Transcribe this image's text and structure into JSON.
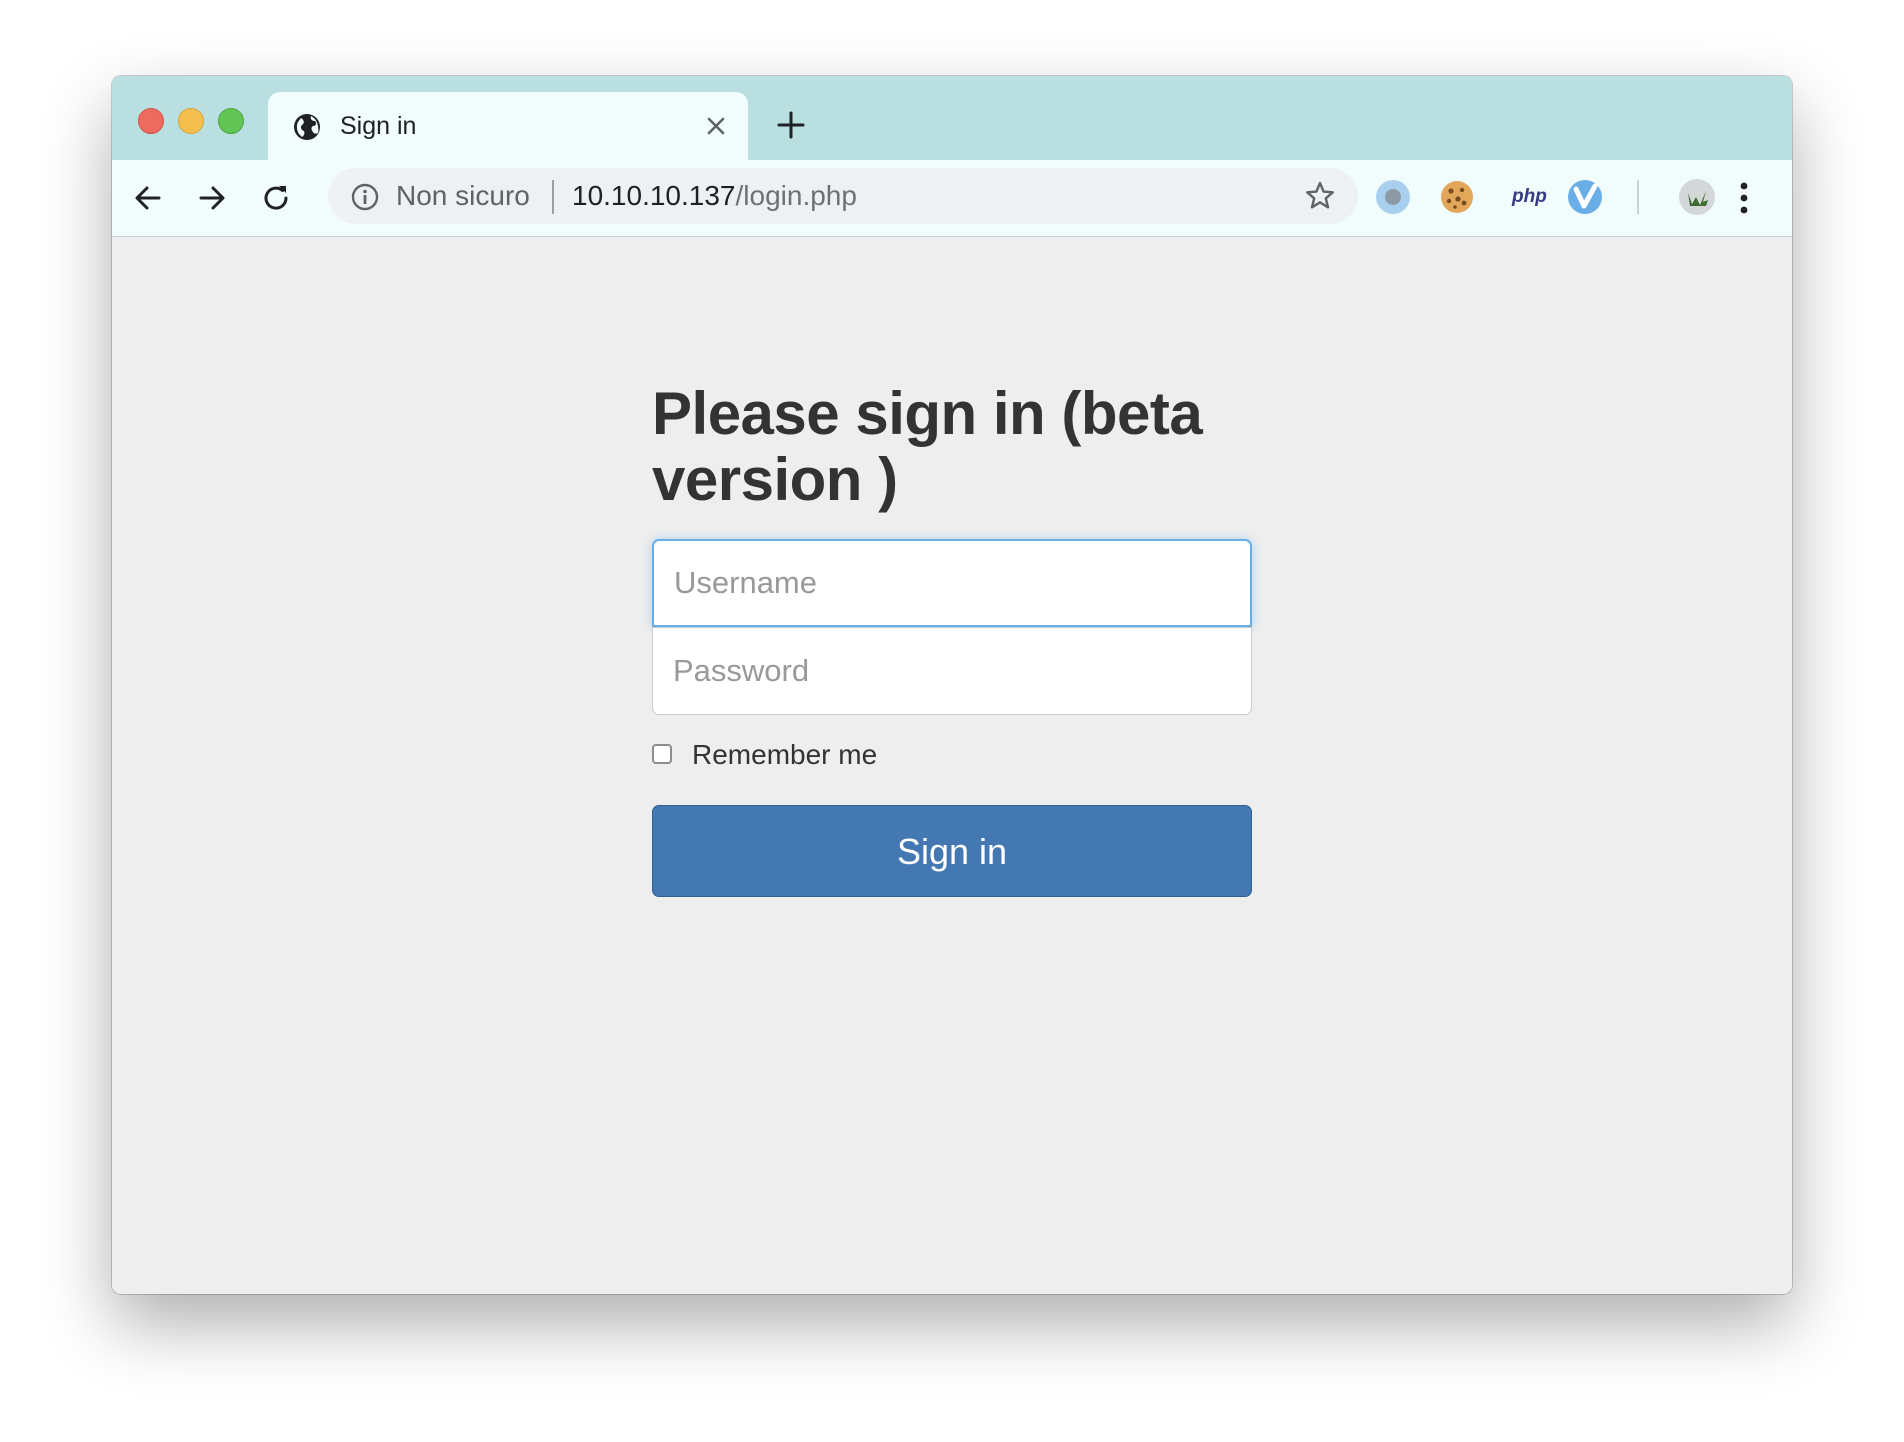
{
  "browser": {
    "tab": {
      "title": "Sign in"
    },
    "address_bar": {
      "security_label": "Non sicuro",
      "url_host": "10.10.10.137",
      "url_path": "/login.php"
    },
    "extensions": {
      "php_label": "php"
    },
    "colors": {
      "titlebar": "#b9dfe0",
      "tab_background": "#f1fdfd"
    }
  },
  "page": {
    "heading": "Please sign in (beta version )",
    "username": {
      "placeholder": "Username",
      "value": ""
    },
    "password": {
      "placeholder": "Password",
      "value": ""
    },
    "remember_me": {
      "label": "Remember me",
      "checked": false
    },
    "submit_label": "Sign in",
    "colors": {
      "primary_button": "#4478b2",
      "focus_ring": "#66afe9",
      "page_background": "#eeeeee"
    }
  }
}
